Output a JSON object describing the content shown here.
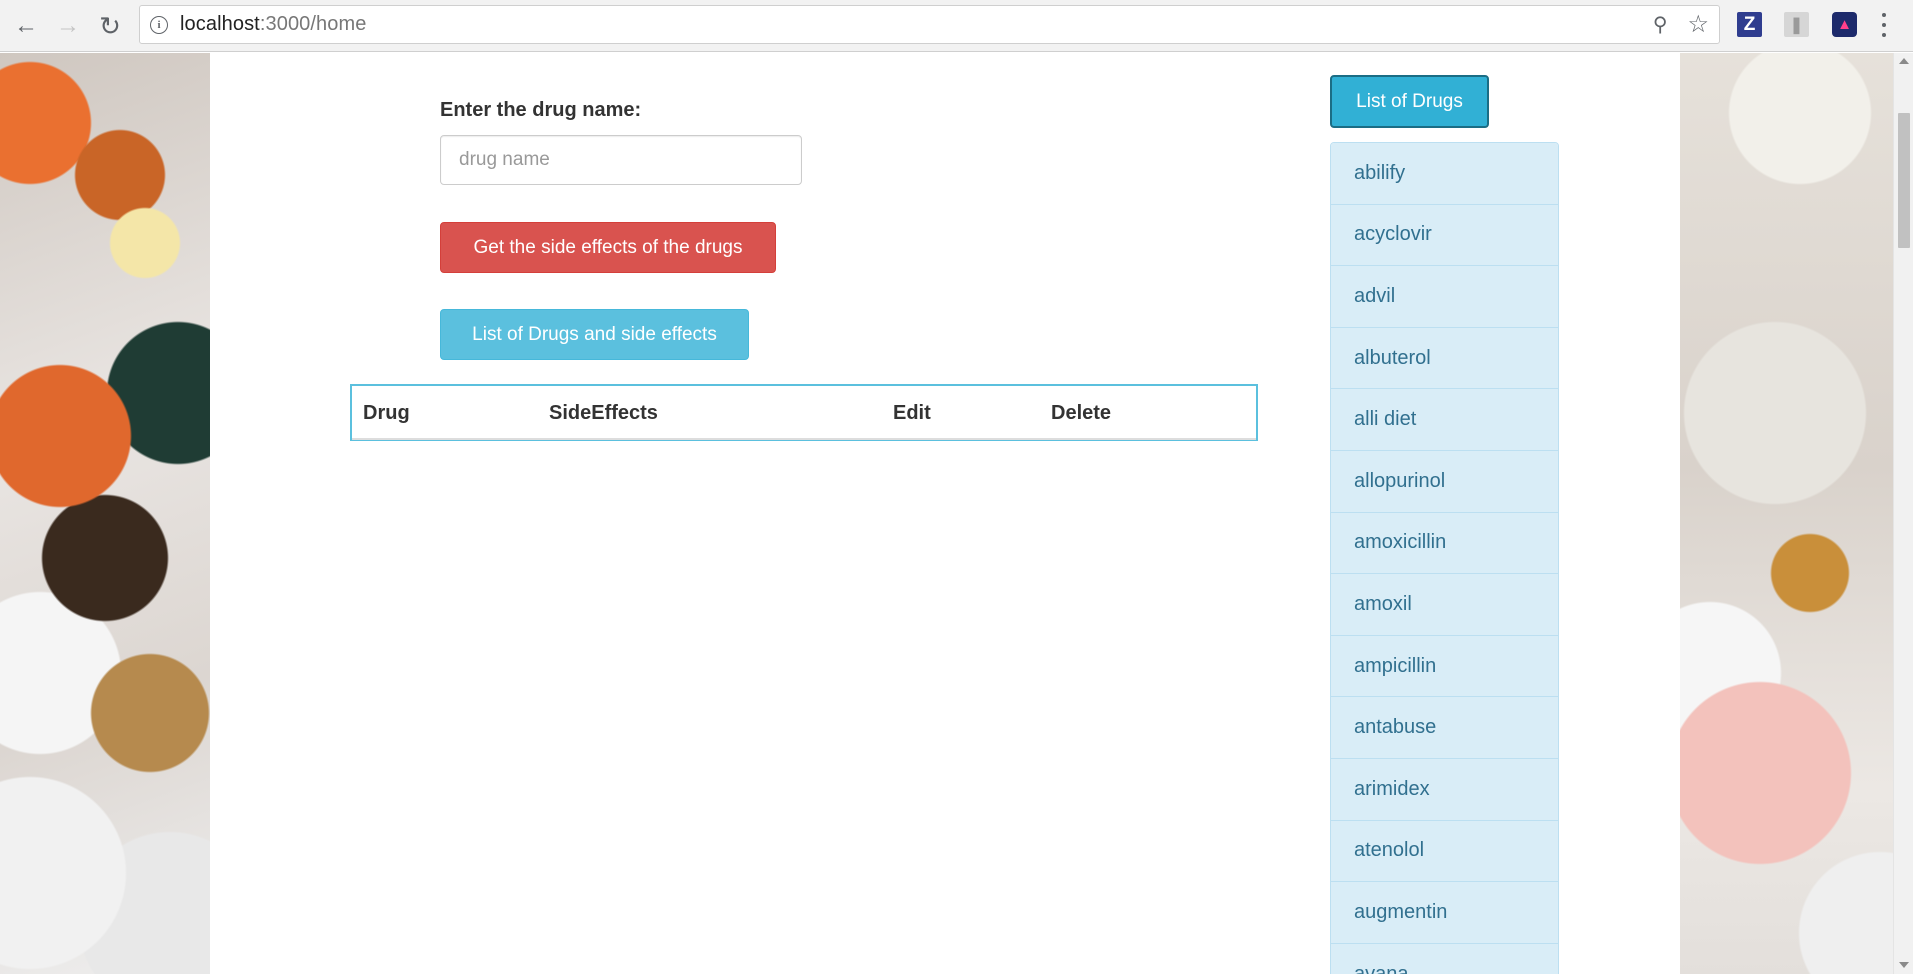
{
  "browser": {
    "url_host": "localhost",
    "url_rest": ":3000/home",
    "extensions": [
      "zotero-icon",
      "pdf-icon",
      "colorzilla-icon"
    ],
    "z_label": "Z"
  },
  "form": {
    "label": "Enter the drug name:",
    "input_value": "",
    "input_placeholder": "drug name",
    "get_side_effects_button": "Get the side effects of the drugs",
    "list_drugs_side_effects_button": "List of Drugs and side effects"
  },
  "table": {
    "headers": [
      "Drug",
      "SideEffects",
      "Edit",
      "Delete"
    ]
  },
  "sidebar": {
    "list_button": "List of Drugs",
    "items": [
      "abilify",
      "acyclovir",
      "advil",
      "albuterol",
      "alli diet",
      "allopurinol",
      "amoxicillin",
      "amoxil",
      "ampicillin",
      "antabuse",
      "arimidex",
      "atenolol",
      "augmentin",
      "avana"
    ]
  },
  "colors": {
    "danger": "#d9534f",
    "info": "#5bc0de",
    "info_active": "#31b0d5",
    "list_item_bg": "#d9edf7",
    "list_item_text": "#31708f"
  }
}
